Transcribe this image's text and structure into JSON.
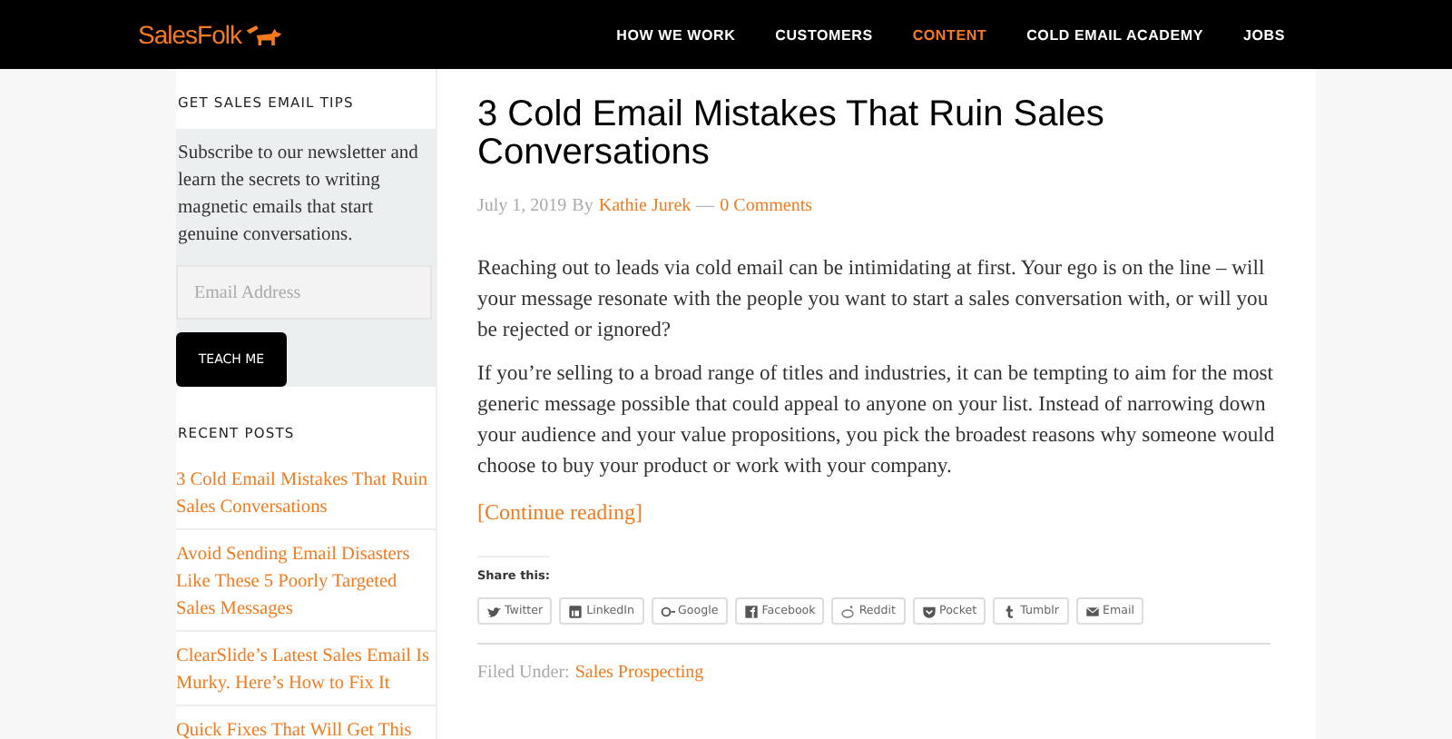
{
  "header": {
    "logo": "SalesFolk",
    "nav": [
      {
        "label": "HOW WE WORK",
        "selected": false
      },
      {
        "label": "CUSTOMERS",
        "selected": false
      },
      {
        "label": "CONTENT",
        "selected": true
      },
      {
        "label": "COLD EMAIL ACADEMY",
        "selected": false
      },
      {
        "label": "JOBS",
        "selected": false
      }
    ]
  },
  "sidebar": {
    "signup": {
      "heading": "GET SALES EMAIL TIPS",
      "text": "Subscribe to our newsletter and learn the secrets to writing magnetic emails that start genuine conversations.",
      "placeholder": "Email Address",
      "button": "TEACH ME"
    },
    "recent": {
      "heading": "RECENT POSTS",
      "items": [
        "3 Cold Email Mistakes That Ruin Sales Conversations",
        "Avoid Sending Email Disasters Like These 5 Poorly Targeted Sales Messages",
        "ClearSlide’s Latest Sales Email Is Murky. Here’s How to Fix It",
        "Quick Fixes That Will Get This"
      ]
    }
  },
  "post": {
    "title": "3 Cold Email Mistakes That Ruin Sales Conversations",
    "date": "July 1, 2019",
    "by": "By",
    "author": "Kathie Jurek",
    "dash": "—",
    "comments": "0 Comments",
    "paragraphs": [
      "Reaching out to leads via cold email can be intimidating at first. Your ego is on the line – will your message resonate with the people you want to start a sales conversation with, or will you be rejected or ignored?",
      "If you’re selling to a broad range of titles and industries, it can be tempting to aim for the most generic message possible that could appeal to anyone on your list. Instead of narrowing down your audience and your value propositions, you pick the broadest reasons why someone would choose to buy your product or work with your company."
    ],
    "more": "[Continue reading]",
    "share_label": "Share this:",
    "share": [
      {
        "kind": "twitter",
        "label": "Twitter"
      },
      {
        "kind": "linkedin",
        "label": "LinkedIn"
      },
      {
        "kind": "google",
        "label": "Google"
      },
      {
        "kind": "facebook",
        "label": "Facebook"
      },
      {
        "kind": "reddit",
        "label": "Reddit"
      },
      {
        "kind": "pocket",
        "label": "Pocket"
      },
      {
        "kind": "tumblr",
        "label": "Tumblr"
      },
      {
        "kind": "email",
        "label": "Email"
      }
    ],
    "filed_label": "Filed Under:",
    "category": "Sales Prospecting"
  }
}
